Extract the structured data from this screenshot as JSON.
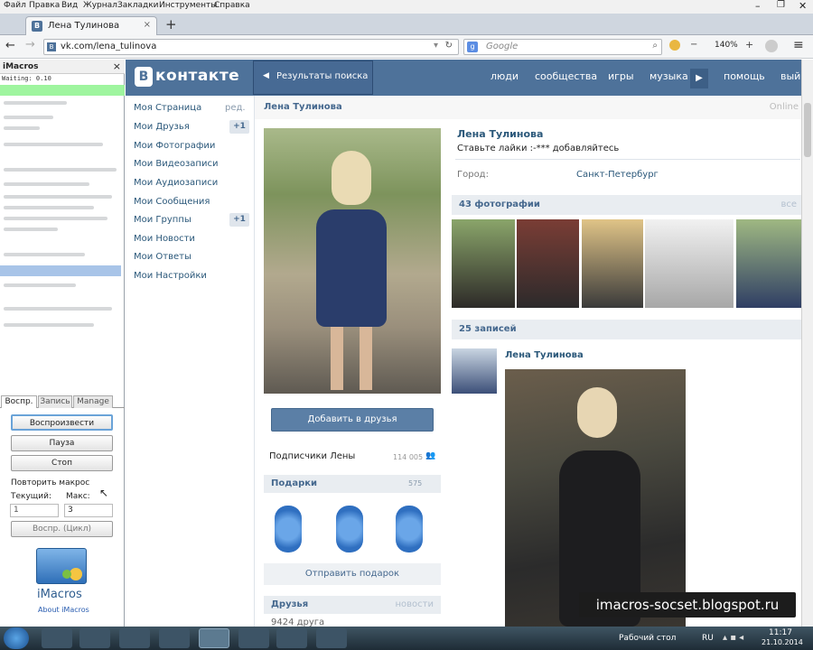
{
  "menu": [
    "Файл",
    "Правка",
    "Вид",
    "Журнал",
    "Закладки",
    "Инструменты",
    "Справка"
  ],
  "tab": {
    "title": "Лена Тулинова",
    "new": "+"
  },
  "url": "vk.com/lena_tulinova",
  "search_placeholder": "Google",
  "zoom": "140%",
  "imacros": {
    "title": "iMacros",
    "close": "×",
    "status": "Waiting: 0.10",
    "tabs": [
      "Воспр.",
      "Запись",
      "Manage"
    ],
    "play": "Воспроизвести",
    "pause": "Пауза",
    "stop": "Стоп",
    "repeat": "Повторить макрос",
    "current_label": "Текущий:",
    "max_label": "Макс:",
    "current": "1",
    "max": "3",
    "loop": "Воспр. (Цикл)",
    "logo": "iMacros",
    "about": "About iMacros"
  },
  "vk": {
    "logo_b": "В",
    "logo": "контакте",
    "back": "Результаты поиска",
    "nav": [
      "люди",
      "сообщества",
      "игры",
      "музыка",
      "помощь",
      "вый"
    ]
  },
  "leftnav": {
    "edit": "ред.",
    "items": [
      "Моя Страница",
      "Мои Друзья",
      "Мои Фотографии",
      "Мои Видеозаписи",
      "Мои Аудиозаписи",
      "Мои Сообщения",
      "Мои Группы",
      "Мои Новости",
      "Мои Ответы",
      "Мои Настройки"
    ],
    "friends_count": "+1",
    "groups_count": "+1"
  },
  "profile": {
    "name": "Лена Тулинова",
    "online": "Online",
    "status": "Ставьте лайки :-*** добавляйтесь",
    "city_label": "Город:",
    "city": "Санкт-Петербург",
    "add_friend": "Добавить в друзья",
    "subs": "Подписчики Лены",
    "subs_count": "114 005",
    "gifts": "Подарки",
    "gifts_count": "575",
    "send_gift": "Отправить подарок",
    "friends": "Друзья",
    "news": "новости",
    "friends_count": "9424 друга",
    "photos": "43 фотографии",
    "all": "все",
    "posts": "25 записей",
    "post_author": "Лена Тулинова"
  },
  "watermark": "imacros-socset.blogspot.ru",
  "taskbar": {
    "desktop": "Рабочий стол",
    "lang": "RU",
    "time": "11:17",
    "date": "21.10.2014"
  }
}
